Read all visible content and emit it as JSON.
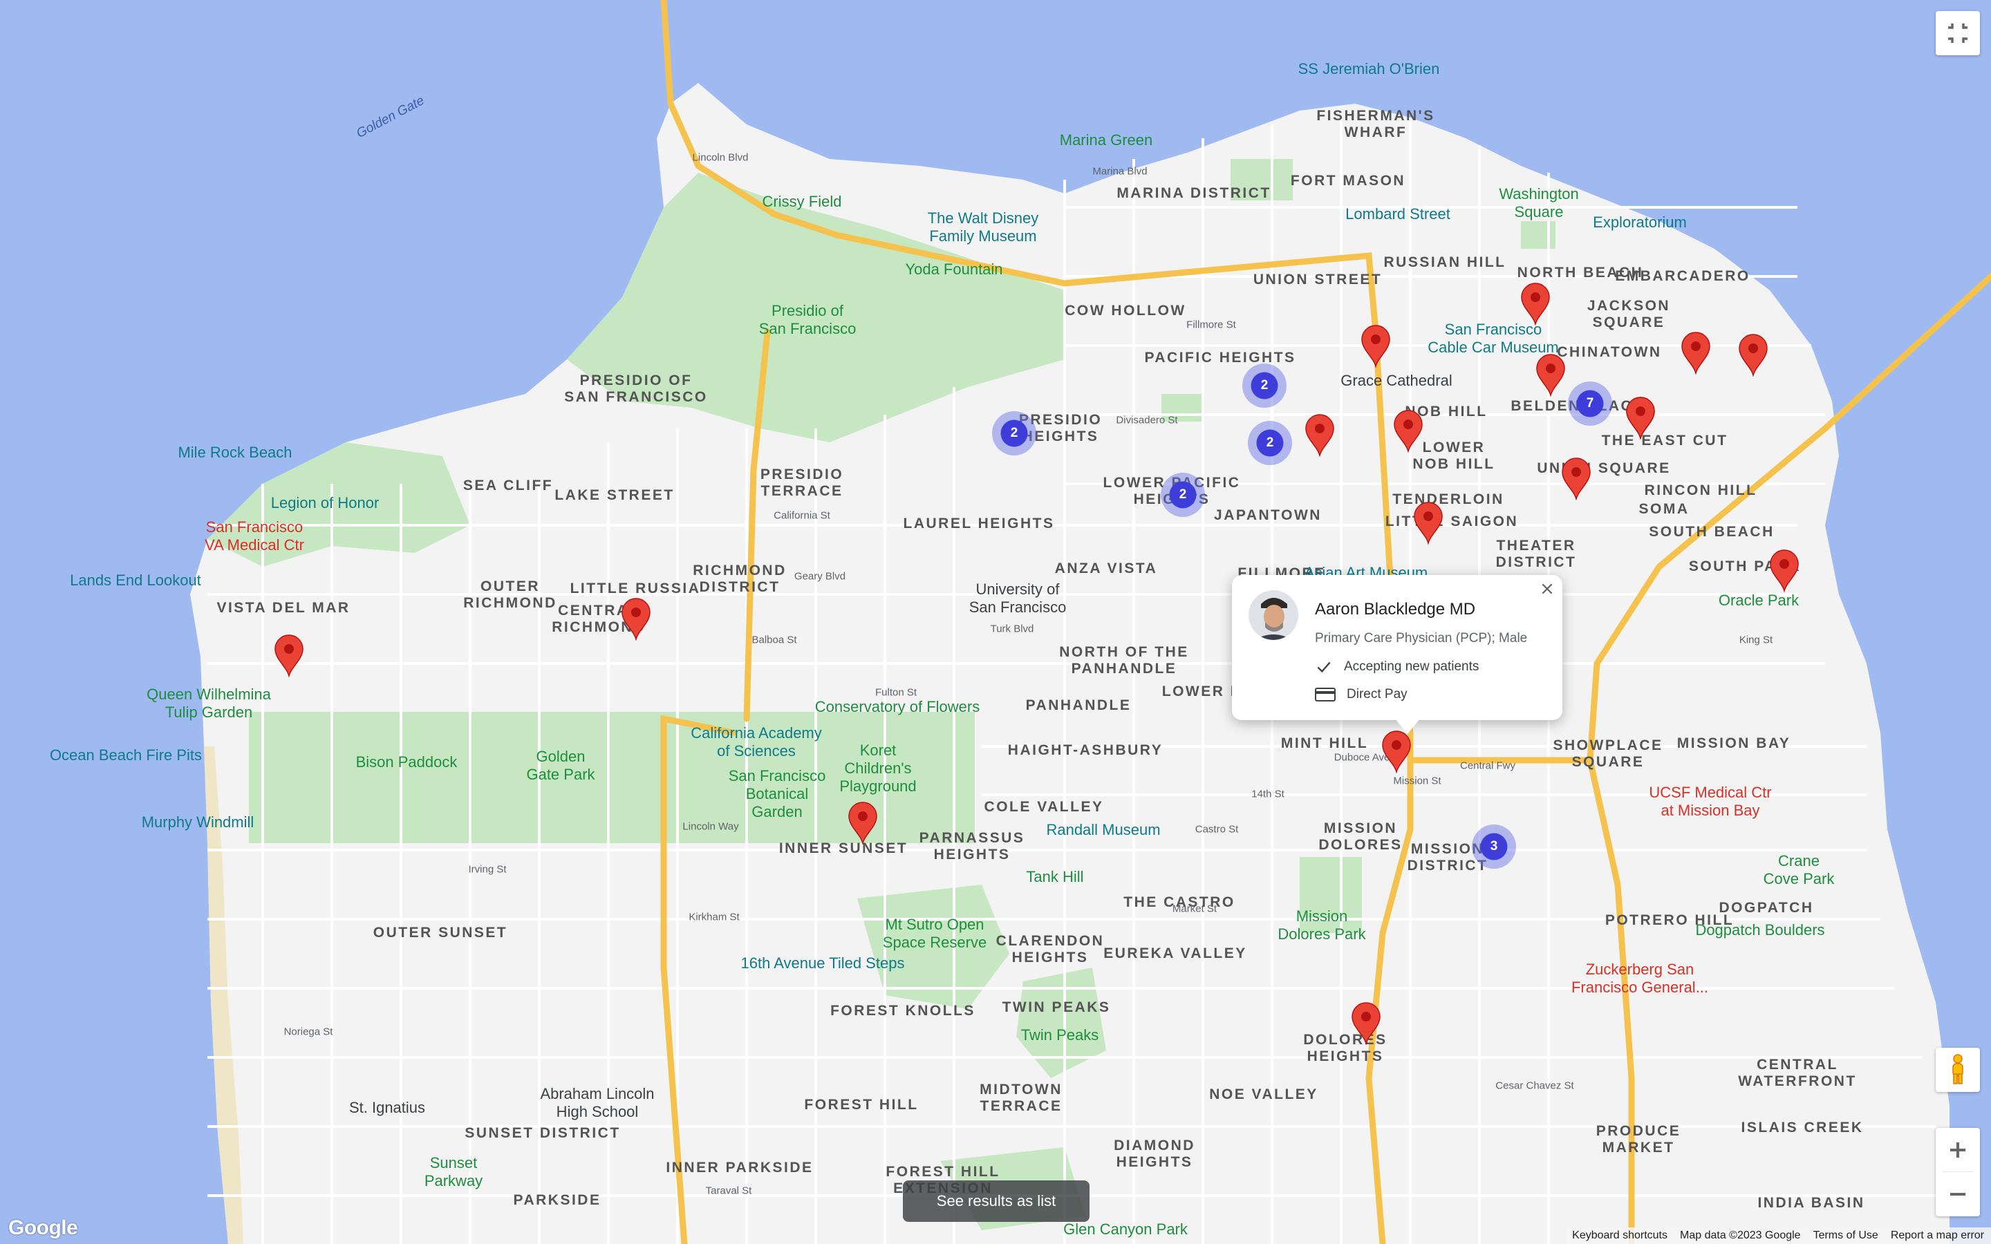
{
  "map": {
    "colors": {
      "water": "#9fb9f1",
      "land": "#f3f3f3",
      "park": "#c7e7c2",
      "highway": "#f5c34d",
      "arterial": "#ffffff",
      "marker": "#ea4335",
      "cluster": "#3f3dd9"
    },
    "district_labels": [
      {
        "id": "fishermans-wharf",
        "text": "FISHERMAN'S\nWHARF"
      },
      {
        "id": "fort-mason",
        "text": "FORT MASON"
      },
      {
        "id": "marina-district",
        "text": "MARINA DISTRICT"
      },
      {
        "id": "russian-hill",
        "text": "RUSSIAN HILL"
      },
      {
        "id": "north-beach",
        "text": "NORTH BEACH"
      },
      {
        "id": "embarcadero",
        "text": "EMBARCADERO"
      },
      {
        "id": "union-street",
        "text": "UNION STREET"
      },
      {
        "id": "cow-hollow",
        "text": "COW HOLLOW"
      },
      {
        "id": "jackson-square",
        "text": "JACKSON\nSQUARE"
      },
      {
        "id": "pacific-heights",
        "text": "PACIFIC HEIGHTS"
      },
      {
        "id": "chinatown",
        "text": "CHINATOWN"
      },
      {
        "id": "presidio-of-sf",
        "text": "PRESIDIO OF\nSAN FRANCISCO"
      },
      {
        "id": "presidio-heights",
        "text": "PRESIDIO\nHEIGHTS"
      },
      {
        "id": "nob-hill",
        "text": "NOB HILL"
      },
      {
        "id": "beacon-place",
        "text": "BELDEN PLACE"
      },
      {
        "id": "the-east-cut",
        "text": "THE EAST CUT"
      },
      {
        "id": "lower-nob-hill",
        "text": "LOWER\nNOB HILL"
      },
      {
        "id": "union-square",
        "text": "UNION SQUARE"
      },
      {
        "id": "rincon-hill",
        "text": "RINCON HILL"
      },
      {
        "id": "sea-cliff",
        "text": "SEA CLIFF"
      },
      {
        "id": "lake-street",
        "text": "LAKE STREET"
      },
      {
        "id": "presidio-terrace",
        "text": "PRESIDIO\nTERRACE"
      },
      {
        "id": "lower-pacific-heights",
        "text": "LOWER PACIFIC\nHEIGHTS"
      },
      {
        "id": "tenderloin",
        "text": "TENDERLOIN"
      },
      {
        "id": "soma",
        "text": "SOMA"
      },
      {
        "id": "laurel-heights",
        "text": "LAUREL HEIGHTS"
      },
      {
        "id": "japantown",
        "text": "JAPANTOWN"
      },
      {
        "id": "little-saigon",
        "text": "LITTLE SAIGON"
      },
      {
        "id": "south-beach",
        "text": "SOUTH BEACH"
      },
      {
        "id": "theater-district",
        "text": "THEATER\nDISTRICT"
      },
      {
        "id": "richmond-district",
        "text": "RICHMOND\nDISTRICT"
      },
      {
        "id": "anza-vista",
        "text": "ANZA VISTA"
      },
      {
        "id": "south-park",
        "text": "SOUTH PARK"
      },
      {
        "id": "outer-richmond",
        "text": "OUTER\nRICHMOND"
      },
      {
        "id": "little-russia",
        "text": "LITTLE RUSSIA"
      },
      {
        "id": "fillmore",
        "text": "FILLMORE"
      },
      {
        "id": "vista-del-mar",
        "text": "VISTA DEL MAR"
      },
      {
        "id": "central-richmond",
        "text": "CENTRAL\nRICHMOND"
      },
      {
        "id": "north-of-panhandle",
        "text": "NORTH OF THE\nPANHANDLE"
      },
      {
        "id": "lower-haight",
        "text": "LOWER HAIGHT"
      },
      {
        "id": "panhandle",
        "text": "PANHANDLE"
      },
      {
        "id": "mission-bay",
        "text": "MISSION BAY"
      },
      {
        "id": "mint-hill",
        "text": "MINT HILL"
      },
      {
        "id": "haight-ashbury",
        "text": "HAIGHT-ASHBURY"
      },
      {
        "id": "showplace-square",
        "text": "SHOWPLACE\nSQUARE"
      },
      {
        "id": "cole-valley",
        "text": "COLE VALLEY"
      },
      {
        "id": "mission-dolores",
        "text": "MISSION\nDOLORES"
      },
      {
        "id": "inner-sunset",
        "text": "INNER SUNSET"
      },
      {
        "id": "parnassus-heights",
        "text": "PARNASSUS\nHEIGHTS"
      },
      {
        "id": "mission-district",
        "text": "MISSION\nDISTRICT"
      },
      {
        "id": "potrero-hill",
        "text": "POTRERO HILL"
      },
      {
        "id": "dogpatch",
        "text": "DOGPATCH"
      },
      {
        "id": "the-castro",
        "text": "THE CASTRO"
      },
      {
        "id": "outer-sunset",
        "text": "OUTER SUNSET"
      },
      {
        "id": "clarendon-heights",
        "text": "CLARENDON\nHEIGHTS"
      },
      {
        "id": "eureka-valley",
        "text": "EUREKA VALLEY"
      },
      {
        "id": "twin-peaks",
        "text": "TWIN PEAKS"
      },
      {
        "id": "forest-knolls",
        "text": "FOREST KNOLLS"
      },
      {
        "id": "dolores-heights",
        "text": "DOLORES\nHEIGHTS"
      },
      {
        "id": "central-waterfront",
        "text": "CENTRAL\nWATERFRONT"
      },
      {
        "id": "noe-valley",
        "text": "NOE VALLEY"
      },
      {
        "id": "midtown-terrace",
        "text": "MIDTOWN\nTERRACE"
      },
      {
        "id": "forest-hill",
        "text": "FOREST HILL"
      },
      {
        "id": "sunset-district",
        "text": "SUNSET DISTRICT"
      },
      {
        "id": "produce-market",
        "text": "PRODUCE\nMARKET"
      },
      {
        "id": "islais-creek",
        "text": "ISLAIS CREEK"
      },
      {
        "id": "diamond-heights",
        "text": "DIAMOND\nHEIGHTS"
      },
      {
        "id": "inner-parkside",
        "text": "INNER PARKSIDE"
      },
      {
        "id": "forest-hill-extension",
        "text": "FOREST HILL\nEXTENSION"
      },
      {
        "id": "parkside",
        "text": "PARKSIDE"
      },
      {
        "id": "india-basin",
        "text": "INDIA BASIN"
      }
    ],
    "poi_labels": [
      {
        "id": "jeremiah-obrien",
        "text": "SS Jeremiah O'Brien",
        "color": "teal"
      },
      {
        "id": "marina-green",
        "text": "Marina Green",
        "color": "green"
      },
      {
        "id": "crissy-field",
        "text": "Crissy Field",
        "color": "green"
      },
      {
        "id": "walt-disney-museum",
        "text": "The Walt Disney\nFamily Museum",
        "color": "teal"
      },
      {
        "id": "lombard-street",
        "text": "Lombard Street",
        "color": "teal"
      },
      {
        "id": "washington-square",
        "text": "Washington\nSquare",
        "color": "green"
      },
      {
        "id": "exploratorium",
        "text": "Exploratorium",
        "color": "teal"
      },
      {
        "id": "yoda-fountain",
        "text": "Yoda Fountain",
        "color": "green"
      },
      {
        "id": "presidio-sf",
        "text": "Presidio of\nSan Francisco",
        "color": "green"
      },
      {
        "id": "cable-car-museum",
        "text": "San Francisco\nCable Car Museum",
        "color": "teal"
      },
      {
        "id": "grace-cathedral",
        "text": "Grace Cathedral",
        "color": "gray"
      },
      {
        "id": "mile-rock-beach",
        "text": "Mile Rock Beach",
        "color": "teal"
      },
      {
        "id": "legion-of-honor",
        "text": "Legion of Honor",
        "color": "teal"
      },
      {
        "id": "va-medical",
        "text": "San Francisco\nVA Medical Ctr",
        "color": "red"
      },
      {
        "id": "lands-end",
        "text": "Lands End Lookout",
        "color": "teal"
      },
      {
        "id": "asian-art-museum",
        "text": "Asian Art Museum",
        "color": "teal"
      },
      {
        "id": "usf",
        "text": "University of\nSan Francisco",
        "color": "gray"
      },
      {
        "id": "oracle-park",
        "text": "Oracle Park",
        "color": "green"
      },
      {
        "id": "queen-wilhelmina",
        "text": "Queen Wilhelmina\nTulip Garden",
        "color": "green"
      },
      {
        "id": "conservatory",
        "text": "Conservatory of Flowers",
        "color": "green"
      },
      {
        "id": "cal-academy",
        "text": "California Academy\nof Sciences",
        "color": "teal"
      },
      {
        "id": "ocean-beach-fire-pits",
        "text": "Ocean Beach Fire Pits",
        "color": "teal"
      },
      {
        "id": "bison-paddock",
        "text": "Bison Paddock",
        "color": "green"
      },
      {
        "id": "golden-gate-park",
        "text": "Golden\nGate Park",
        "color": "green"
      },
      {
        "id": "koret-playground",
        "text": "Koret\nChildren's\nPlayground",
        "color": "green"
      },
      {
        "id": "botanical-garden",
        "text": "San Francisco\nBotanical\nGarden",
        "color": "green"
      },
      {
        "id": "ucsf-mission-bay",
        "text": "UCSF Medical Ctr\nat Mission Bay",
        "color": "red"
      },
      {
        "id": "murphy-windmill",
        "text": "Murphy Windmill",
        "color": "teal"
      },
      {
        "id": "randall-museum",
        "text": "Randall Museum",
        "color": "teal"
      },
      {
        "id": "crane-cove-park",
        "text": "Crane\nCove Park",
        "color": "green"
      },
      {
        "id": "tank-hill",
        "text": "Tank Hill",
        "color": "green"
      },
      {
        "id": "mission-dolores-park",
        "text": "Mission\nDolores Park",
        "color": "green"
      },
      {
        "id": "sutro-open-space",
        "text": "Mt Sutro Open\nSpace Reserve",
        "color": "green"
      },
      {
        "id": "dogpatch-boulders",
        "text": "Dogpatch Boulders",
        "color": "green"
      },
      {
        "id": "tiled-steps",
        "text": "16th Avenue Tiled Steps",
        "color": "teal"
      },
      {
        "id": "zuckerberg-sf-general",
        "text": "Zuckerberg San\nFrancisco General...",
        "color": "red"
      },
      {
        "id": "twin-peaks-poi",
        "text": "Twin Peaks",
        "color": "green"
      },
      {
        "id": "st-ignatius",
        "text": "St. Ignatius",
        "color": "gray"
      },
      {
        "id": "abraham-lincoln-hs",
        "text": "Abraham Lincoln\nHigh School",
        "color": "gray"
      },
      {
        "id": "sunset-parkway",
        "text": "Sunset\nParkway",
        "color": "green"
      },
      {
        "id": "glen-canyon-park",
        "text": "Glen Canyon Park",
        "color": "green"
      }
    ],
    "water_labels": [
      {
        "id": "golden-gate",
        "text": "Golden Gate"
      }
    ],
    "street_labels": [
      {
        "id": "marina-blvd",
        "text": "Marina Blvd"
      },
      {
        "id": "lincoln-blvd",
        "text": "Lincoln Blvd"
      },
      {
        "id": "california-st",
        "text": "California St"
      },
      {
        "id": "geary-blvd",
        "text": "Geary Blvd"
      },
      {
        "id": "balboa-st",
        "text": "Balboa St"
      },
      {
        "id": "fulton-st",
        "text": "Fulton St"
      },
      {
        "id": "lincoln-way",
        "text": "Lincoln Way"
      },
      {
        "id": "irving-st",
        "text": "Irving St"
      },
      {
        "id": "kirkham-st",
        "text": "Kirkham St"
      },
      {
        "id": "noriega-st",
        "text": "Noriega St"
      },
      {
        "id": "taraval-st",
        "text": "Taraval St"
      },
      {
        "id": "turk-blvd",
        "text": "Turk Blvd"
      },
      {
        "id": "central-fwy",
        "text": "Central Fwy"
      },
      {
        "id": "14th-st",
        "text": "14th St"
      },
      {
        "id": "duboce-ave",
        "text": "Duboce Ave"
      },
      {
        "id": "cesar-chavez-st",
        "text": "Cesar Chavez St"
      },
      {
        "id": "market-st",
        "text": "Market St"
      },
      {
        "id": "fillmore-st",
        "text": "Fillmore St"
      },
      {
        "id": "divisadero-st",
        "text": "Divisadero St"
      },
      {
        "id": "castro-st",
        "text": "Castro St"
      },
      {
        "id": "mission-st",
        "text": "Mission St"
      },
      {
        "id": "king-st",
        "text": "King St"
      }
    ],
    "markers": [
      {
        "id": "marker-1"
      },
      {
        "id": "marker-2"
      },
      {
        "id": "marker-3"
      },
      {
        "id": "marker-4"
      },
      {
        "id": "marker-5"
      },
      {
        "id": "marker-6"
      },
      {
        "id": "marker-7"
      },
      {
        "id": "marker-8"
      },
      {
        "id": "marker-9"
      },
      {
        "id": "marker-10"
      },
      {
        "id": "marker-11"
      },
      {
        "id": "marker-12"
      },
      {
        "id": "marker-13"
      },
      {
        "id": "marker-14"
      },
      {
        "id": "marker-15"
      },
      {
        "id": "marker-16"
      },
      {
        "id": "marker-17"
      }
    ],
    "clusters": [
      {
        "id": "cluster-presidio-heights",
        "count": "2"
      },
      {
        "id": "cluster-pacific-heights",
        "count": "2"
      },
      {
        "id": "cluster-pacific-heights-south",
        "count": "2"
      },
      {
        "id": "cluster-lower-pacific-heights",
        "count": "2"
      },
      {
        "id": "cluster-belden-place",
        "count": "7"
      },
      {
        "id": "cluster-mission-district",
        "count": "3"
      }
    ]
  },
  "infowindow": {
    "name": "Aaron Blackledge MD",
    "subtitle": "Primary Care Physician (PCP); Male",
    "features": [
      {
        "icon": "check-icon",
        "text": "Accepting new patients"
      },
      {
        "icon": "credit-card-icon",
        "text": "Direct Pay"
      }
    ]
  },
  "controls": {
    "list_button": "See results as list",
    "logo": "Google",
    "attribution": [
      "Keyboard shortcuts",
      "Map data ©2023 Google",
      "Terms of Use",
      "Report a map error"
    ]
  }
}
